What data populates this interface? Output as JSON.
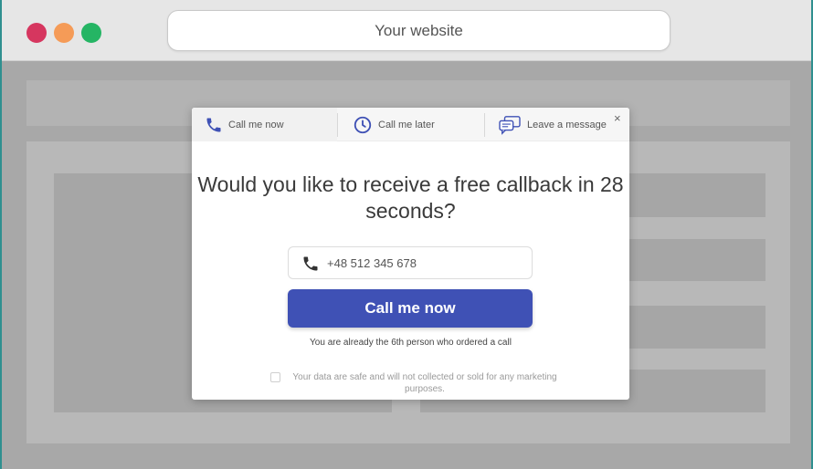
{
  "browser": {
    "url_text": "Your website",
    "colors": {
      "close": "#d6365f",
      "minimize": "#f59b57",
      "maximize": "#25b564"
    }
  },
  "modal": {
    "tabs": [
      {
        "label": "Call me now",
        "icon": "phone-icon"
      },
      {
        "label": "Call me later",
        "icon": "clock-icon"
      },
      {
        "label": "Leave a message",
        "icon": "chat-icon"
      }
    ],
    "close_symbol": "×",
    "headline": "Would you like to receive a free callback in 28 seconds?",
    "phone_value": "+48 512 345 678",
    "cta_label": "Call me now",
    "info_text": "You are already the 6th person who ordered a call",
    "consent_text": "Your data are safe and will not collected or sold for any marketing purposes.",
    "accent_color": "#3f51b5"
  }
}
